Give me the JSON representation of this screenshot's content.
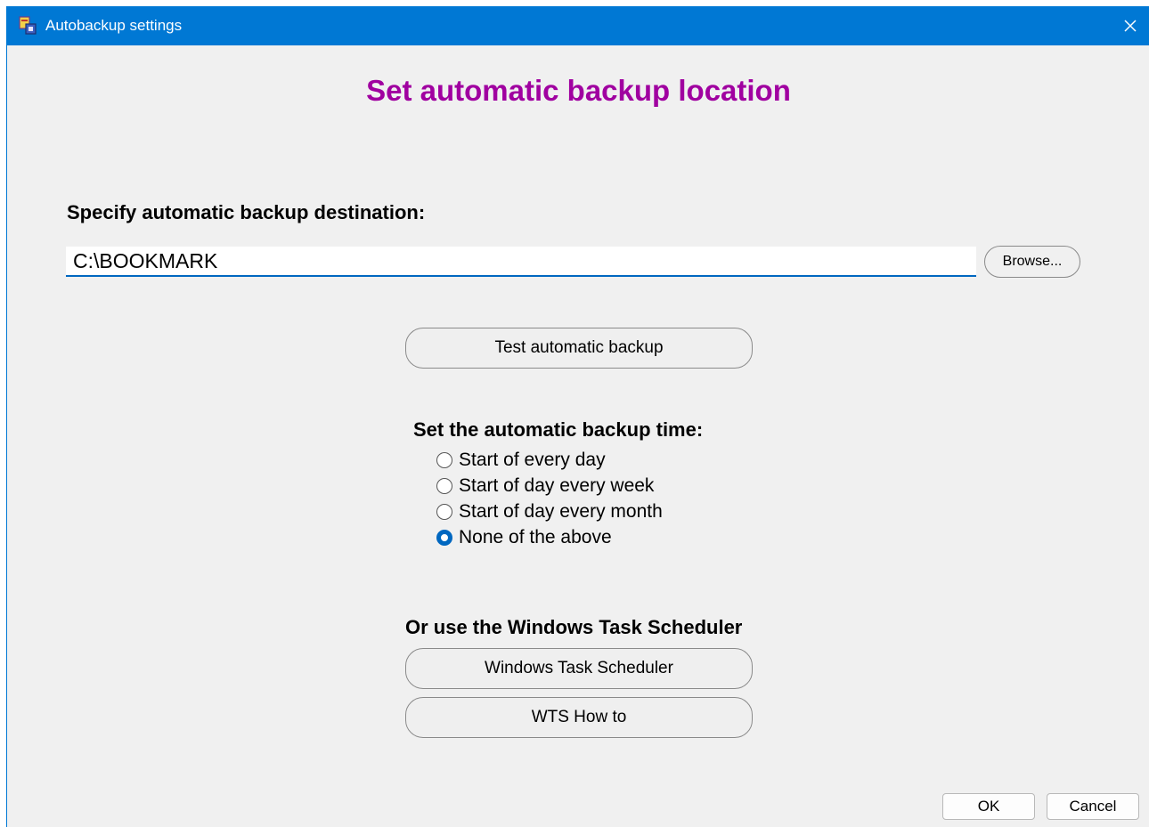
{
  "window": {
    "title": "Autobackup settings",
    "accent_color": "#0078d4",
    "heading": "Set automatic backup location",
    "heading_color": "#a000a0"
  },
  "destination": {
    "label": "Specify automatic backup destination:",
    "path_value": "C:\\BOOKMARK",
    "browse_label": "Browse..."
  },
  "test_button_label": "Test automatic backup",
  "schedule": {
    "label": "Set the automatic backup time:",
    "options": [
      {
        "label": "Start of every day",
        "selected": false
      },
      {
        "label": "Start of day every week",
        "selected": false
      },
      {
        "label": "Start of day every month",
        "selected": false
      },
      {
        "label": "None of the above",
        "selected": true
      }
    ]
  },
  "wts": {
    "label": "Or use the Windows Task Scheduler",
    "scheduler_button": "Windows Task Scheduler",
    "howto_button": "WTS How to"
  },
  "footer": {
    "ok_label": "OK",
    "cancel_label": "Cancel"
  },
  "icons": {
    "app": "bookmark-app-icon",
    "close": "close-icon"
  }
}
